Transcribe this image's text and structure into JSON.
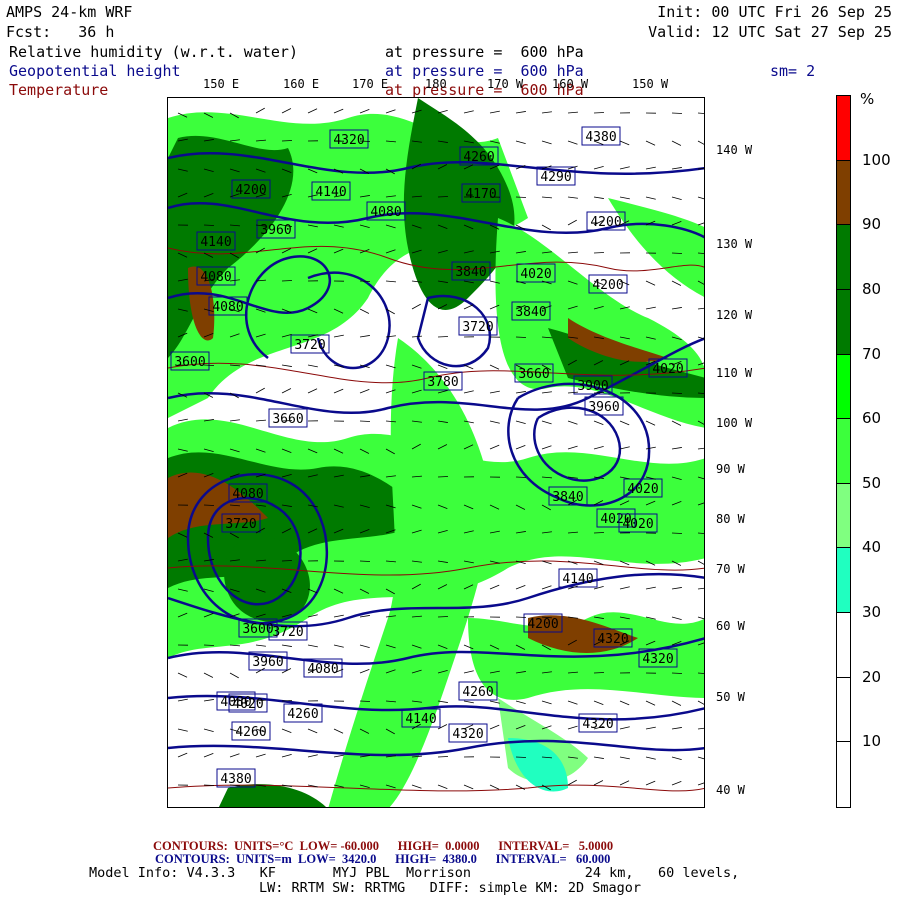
{
  "header": {
    "model": "AMPS 24-km WRF",
    "fcst": "Fcst:   36 h",
    "init": "Init: 00 UTC Fri 26 Sep 25",
    "valid": "Valid: 12 UTC Sat 27 Sep 25",
    "field1_name": "Relative humidity (w.r.t. water)",
    "field1_level": "at pressure =  600 hPa",
    "field2_name": "Geopotential height",
    "field2_level": "at pressure =  600 hPa",
    "smoothing": "sm= 2",
    "field3_name": "Temperature",
    "field3_level": "at pressure =  600 hPa"
  },
  "map": {
    "lon_labels": [
      "150 E",
      "160 E",
      "170 E",
      "180",
      "170 W",
      "160 W",
      "150 W"
    ],
    "lat_labels": [
      "140 W",
      "130 W",
      "120 W",
      "110 W",
      "100 W",
      "90 W",
      "80 W",
      "70 W",
      "60 W",
      "50 W",
      "40 W"
    ],
    "height_labels": [
      "4380",
      "4320",
      "4260",
      "4290",
      "4200",
      "4140",
      "4170",
      "4080",
      "3960",
      "4140",
      "4200",
      "4080",
      "3840",
      "4020",
      "4200",
      "4080",
      "3840",
      "3720",
      "3720",
      "4020",
      "3660",
      "3600",
      "3780",
      "3960",
      "3900",
      "4020",
      "3840",
      "3660",
      "4020",
      "4080",
      "3720",
      "3600",
      "3720",
      "4080",
      "3960",
      "4080",
      "4020",
      "4140",
      "4260",
      "4320",
      "4380",
      "4320",
      "4260",
      "4260",
      "4320",
      "4200",
      "4140",
      "4020",
      "4320"
    ]
  },
  "colorbar": {
    "unit": "%",
    "labels": [
      "100",
      "90",
      "80",
      "70",
      "60",
      "50",
      "40",
      "30",
      "20",
      "10"
    ],
    "colors": [
      "#ff0000",
      "#7f3f00",
      "#007a00",
      "#007a00",
      "#00ff00",
      "#3cff3c",
      "#80ff80",
      "#20ffc0",
      "#ffffff",
      "#ffffff",
      "#ffffff"
    ]
  },
  "footer": {
    "temp_contours": "CONTOURS:  UNITS=°C  LOW= -60.000      HIGH=  0.0000      INTERVAL=   5.0000",
    "height_contours": "CONTOURS:  UNITS=m  LOW=  3420.0      HIGH=  4380.0      INTERVAL=   60.000",
    "model_info": "Model Info: V4.3.3   KF       MYJ PBL  Morrison              24 km,   60 levels,",
    "physics": "LW: RRTM SW: RRTMG   DIFF: simple KM: 2D Smagor"
  },
  "colors": {
    "height": "#0a0a8c",
    "temperature": "#8b0a0a"
  }
}
